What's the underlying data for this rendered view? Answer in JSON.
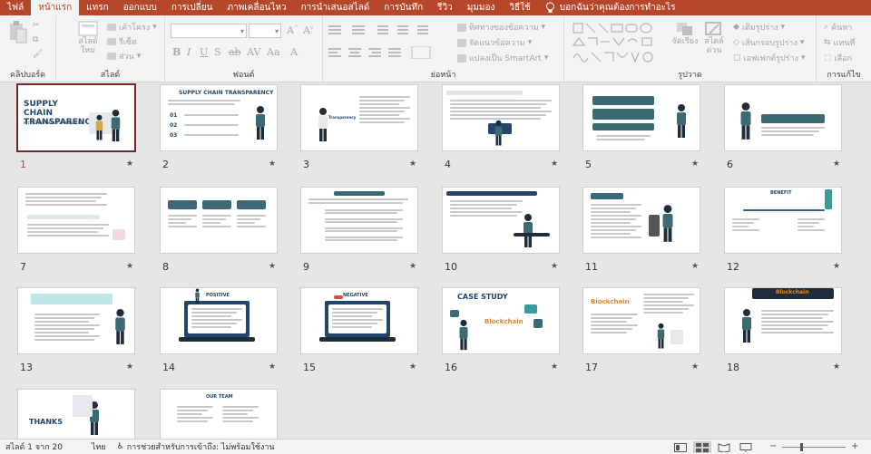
{
  "tabs": [
    "ไฟล์",
    "หน้าแรก",
    "แทรก",
    "ออกแบบ",
    "การเปลี่ยน",
    "ภาพเคลื่อนไหว",
    "การนำเสนอสไลด์",
    "การบันทึก",
    "รีวิว",
    "มุมมอง",
    "วิธีใช้"
  ],
  "active_tab": 1,
  "tell_me": "บอกฉันว่าคุณต้องการทำอะไร",
  "ribbon": {
    "clipboard_label": "คลิปบอร์ด",
    "slides_label": "สไลด์",
    "font_label": "ฟอนต์",
    "paragraph_label": "ย่อหน้า",
    "drawing_label": "รูปวาด",
    "editing_label": "การแก้ไข",
    "new_slide": "สไลด์ ใหม่",
    "layout": "เค้าโครง",
    "reset": "รีเซ็ต",
    "section": "ส่วน",
    "text_direction": "ทิศทางของข้อความ",
    "align_text": "จัดแนวข้อความ",
    "smartart": "แปลงเป็น SmartArt",
    "arrange": "จัดเรียง",
    "quick_styles": "สไตล์ ด่วน",
    "shape_fill": "เติมรูปร่าง",
    "shape_outline": "เส้นกรอบรูปร่าง",
    "shape_effects": "เอฟเฟกต์รูปร่าง",
    "find": "ค้นหา",
    "replace": "แทนที่",
    "select": "เลือก"
  },
  "slides": [
    {
      "num": "1",
      "title": "SUPPLY CHAIN TRANSPARENCY",
      "sub": "ความโปร่งใสในห่วงโซ่อุปทาน"
    },
    {
      "num": "2",
      "title": "SUPPLY CHAIN TRANSPARENCY",
      "bullets": [
        "01",
        "02",
        "03"
      ]
    },
    {
      "num": "3",
      "title": "Transparency"
    },
    {
      "num": "4",
      "title": ""
    },
    {
      "num": "5",
      "title": ""
    },
    {
      "num": "6",
      "title": ""
    },
    {
      "num": "7",
      "title": ""
    },
    {
      "num": "8",
      "title": ""
    },
    {
      "num": "9",
      "title": ""
    },
    {
      "num": "10",
      "title": ""
    },
    {
      "num": "11",
      "title": ""
    },
    {
      "num": "12",
      "title": "BENEFIT"
    },
    {
      "num": "13",
      "title": ""
    },
    {
      "num": "14",
      "title": "POSITIVE"
    },
    {
      "num": "15",
      "title": "NEGATIVE"
    },
    {
      "num": "16",
      "title": "CASE STUDY",
      "sub": "Blockchain"
    },
    {
      "num": "17",
      "title": "Blockchain"
    },
    {
      "num": "18",
      "title": "Blockchain"
    },
    {
      "num": "19",
      "title": "THANKS"
    },
    {
      "num": "20",
      "title": "OUR TEAM"
    }
  ],
  "status": {
    "slide_info": "สไลด์ 1 จาก 20",
    "language": "ไทย",
    "accessibility": "การช่วยสำหรับการเข้าถึง: ไม่พร้อมใช้งาน"
  },
  "colors": {
    "accent": "#b7472a",
    "selected": "#7b2626",
    "navy": "#23466a",
    "teal": "#3b6a74"
  }
}
